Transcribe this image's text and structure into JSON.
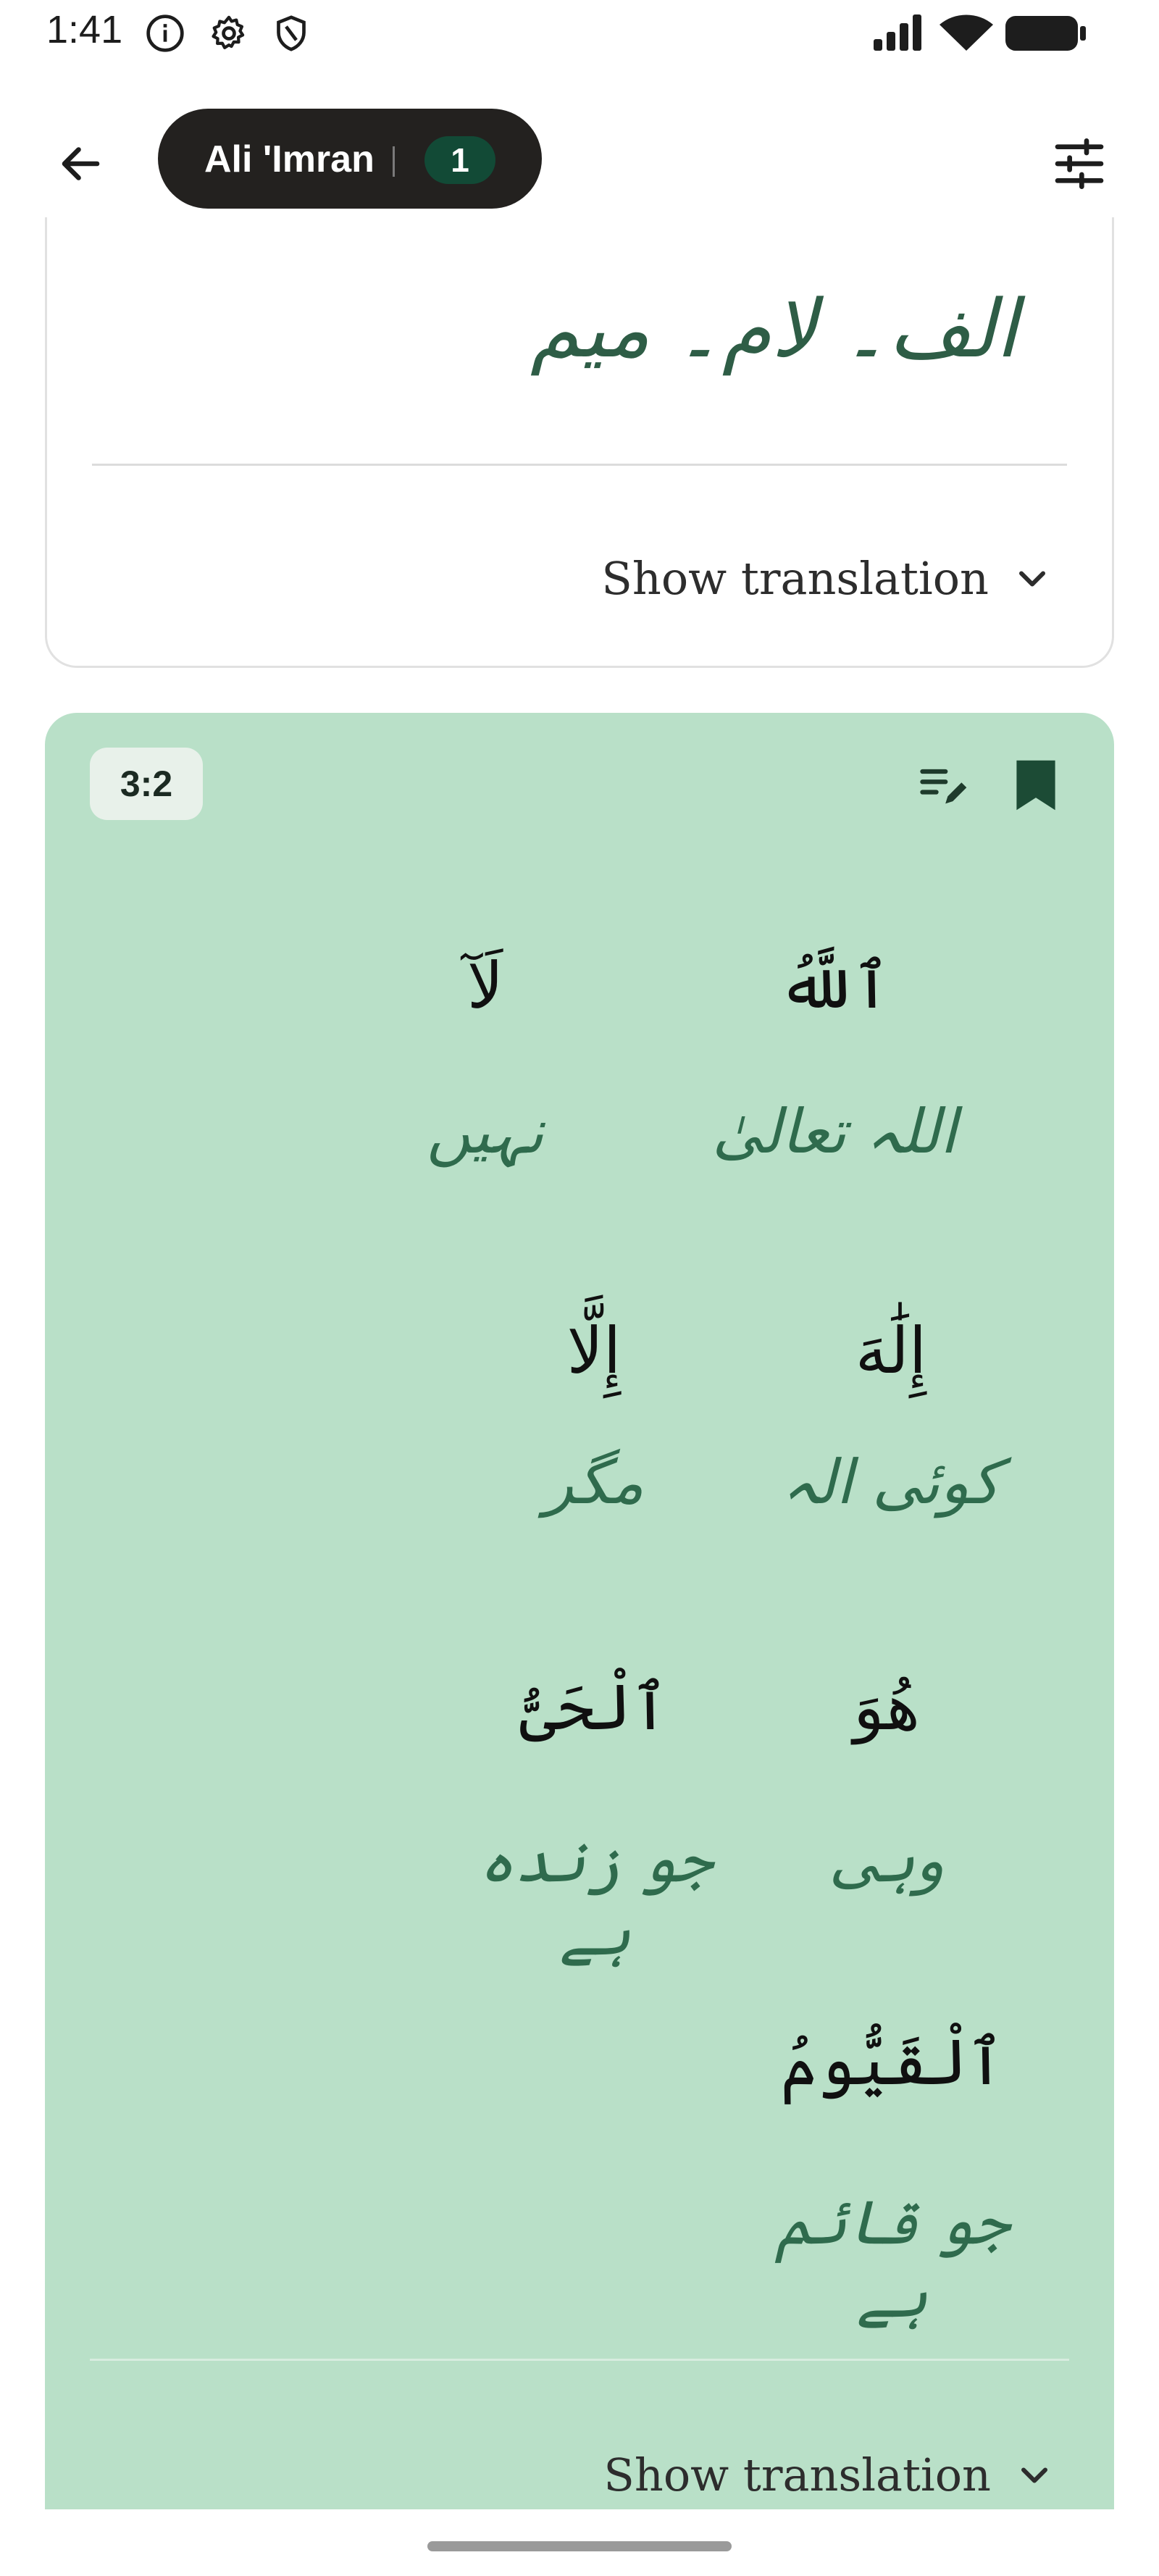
{
  "status_bar": {
    "time": "1:41",
    "left_icons": [
      "info-icon",
      "settings-gear-icon",
      "shield-icon"
    ],
    "right_icons": [
      "signal-icon",
      "wifi-icon",
      "battery-icon"
    ]
  },
  "top_bar": {
    "back_icon": "arrow-back-icon",
    "surah_title": "Ali 'Imran",
    "count": "1",
    "filter_icon": "tune-icon"
  },
  "card1": {
    "arabic_text": "الف۔ لام۔ میم",
    "show_translation": "Show translation"
  },
  "card2": {
    "verse_number": "3:2",
    "accent_color": "#b9e0c8",
    "notes_icon": "edit-note-icon",
    "bookmark_icon": "bookmark-icon",
    "words": [
      {
        "arabic": "ٱللَّهُ",
        "urdu": "اللہ تعالیٰ"
      },
      {
        "arabic": "لَآ",
        "urdu": "نہیں"
      },
      {
        "arabic": "إِلَٰهَ",
        "urdu": "کوئی الہ"
      },
      {
        "arabic": "إِلَّا",
        "urdu": "مگر"
      },
      {
        "arabic": "هُوَ",
        "urdu": "وہی"
      },
      {
        "arabic": "ٱلْحَىُّ",
        "urdu": "جو زندہ ہے"
      },
      {
        "arabic": "ٱلْقَيُّومُ",
        "urdu": "جو قائم ہے"
      }
    ],
    "show_translation": "Show translation"
  }
}
